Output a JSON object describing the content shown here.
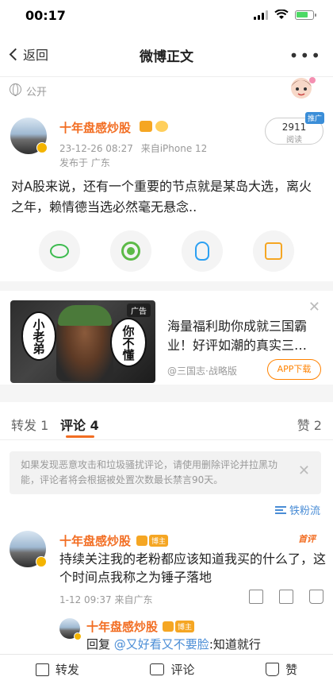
{
  "status_bar": {
    "time": "00:17"
  },
  "nav": {
    "back_label": "返回",
    "title": "微博正文",
    "more": "•••"
  },
  "visibility": {
    "label": "公开"
  },
  "post": {
    "author": "十年盘感炒股",
    "timestamp": "23-12-26 08:27",
    "source": "来自iPhone 12",
    "location": "发布于 广东",
    "read_count": "2911",
    "read_label": "阅读",
    "promo_tag": "推广",
    "text": "对A股来说，还有一个重要的节点就是某岛大选，离火之年，赖情德当选必然毫无悬念..",
    "share_buttons": [
      "wechat-icon",
      "moments-icon",
      "qq-icon",
      "save-image-icon"
    ]
  },
  "ad": {
    "tag": "广告",
    "bubble_left": "小老弟",
    "bubble_right": "你不懂",
    "title": "海量福利助你成就三国霸业！好评如潮的真实三…",
    "source": "@三国志·战略版",
    "button": "APP下载"
  },
  "tabs": {
    "repost": "转发 1",
    "comment": "评论 4",
    "like": "赞 2"
  },
  "notice": {
    "text": "如果发现恶意攻击和垃圾骚扰评论，请使用删除评论并拉黑功能，评论者将会根据被处置次数最长禁言90天。"
  },
  "sort": {
    "label": "铁粉流"
  },
  "comment": {
    "author": "十年盘感炒股",
    "owner_tag": "博主",
    "first_tag": "首评",
    "text": "持续关注我的老粉都应该知道我买的什么了，这个时间点我称之为锤子落地",
    "meta": "1-12 09:37  来自广东"
  },
  "reply": {
    "author": "十年盘感炒股",
    "owner_tag": "博主",
    "prefix": "回复",
    "mention": "@又好看又不要脸",
    "text": ":知道就行"
  },
  "bottom_bar": {
    "repost": "转发",
    "comment": "评论",
    "like": "赞"
  }
}
